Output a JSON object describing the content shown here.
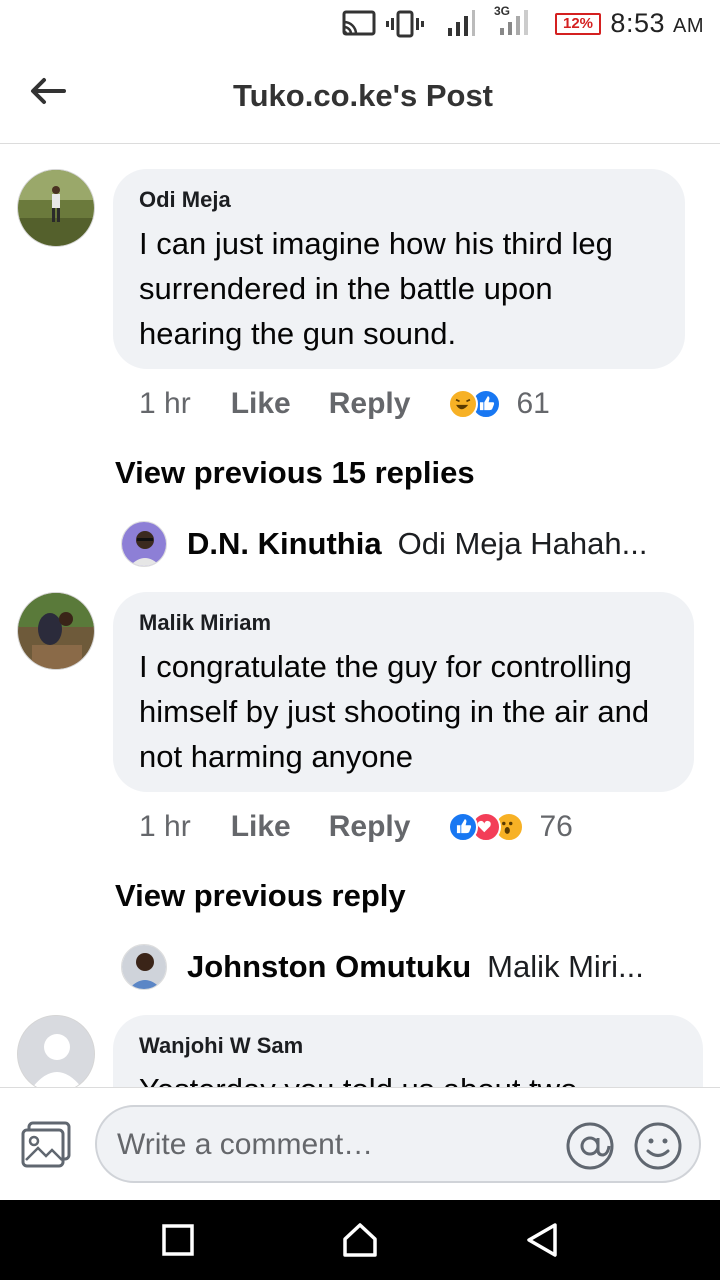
{
  "status_bar": {
    "network": "3G",
    "battery": "12%",
    "time": "8:53",
    "ampm": "AM",
    "icons": [
      "cast-icon",
      "vibrate-icon",
      "signal-icon",
      "signal-3g-icon",
      "battery-icon"
    ]
  },
  "header": {
    "title": "Tuko.co.ke's Post",
    "back_icon": "arrow-left-icon"
  },
  "comments": [
    {
      "author": "Odi Meja",
      "text": "I can just imagine how his third leg surrendered in the battle upon hearing the gun sound.",
      "time": "1 hr",
      "like_label": "Like",
      "reply_label": "Reply",
      "reactions": [
        "haha",
        "like"
      ],
      "reaction_count": "61",
      "view_previous": "View previous 15 replies",
      "latest_reply": {
        "name": "D.N. Kinuthia",
        "preview": "Odi Meja Hahah..."
      }
    },
    {
      "author": "Malik Miriam",
      "text": "I congratulate the guy for controlling himself by just shooting in the air and not harming anyone",
      "time": "1 hr",
      "like_label": "Like",
      "reply_label": "Reply",
      "reactions": [
        "like",
        "love",
        "wow"
      ],
      "reaction_count": "76",
      "view_previous": "View previous reply",
      "latest_reply": {
        "name": "Johnston Omutuku",
        "preview": "Malik Miri..."
      }
    },
    {
      "author": "Wanjohi W Sam",
      "text": "Yesterday you told us about two"
    }
  ],
  "composer": {
    "placeholder": "Write a comment…"
  },
  "colors": {
    "bubble": "#f0f2f5",
    "like_blue": "#1877f2",
    "love_red": "#f33e58",
    "haha_yellow": "#f7b125",
    "battery_red": "#d42020"
  }
}
